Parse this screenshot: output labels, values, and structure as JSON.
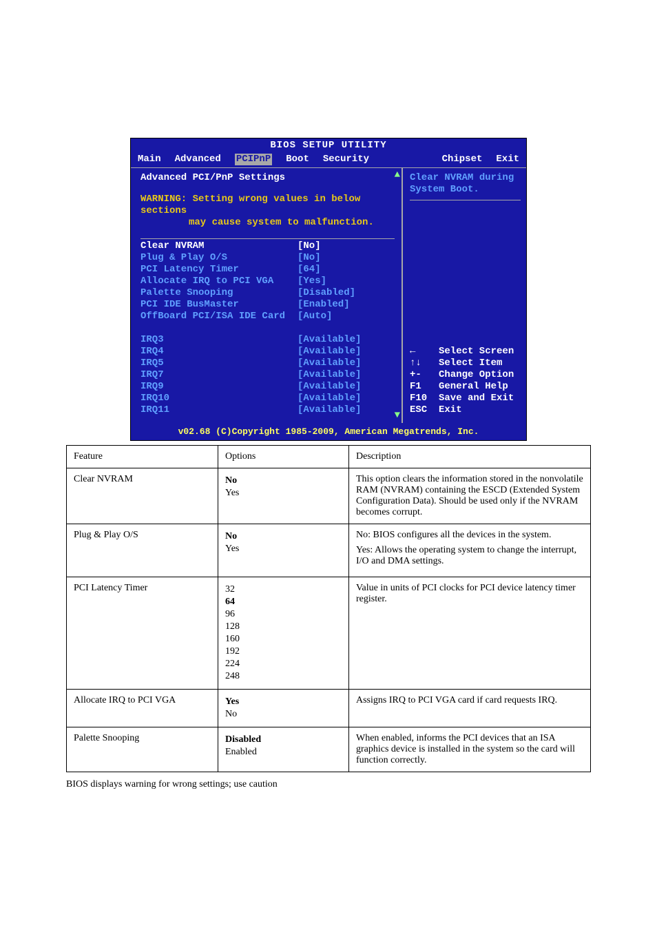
{
  "bios": {
    "title": "BIOS SETUP UTILITY",
    "menu": [
      "Main",
      "Advanced",
      "PCIPnP",
      "Boot",
      "Security",
      "Chipset",
      "Exit"
    ],
    "selected_menu_index": 2,
    "section_heading": "Advanced PCI/PnP Settings",
    "warning_line1": "WARNING: Setting wrong values in below sections",
    "warning_line2": "may cause system to malfunction.",
    "items": [
      {
        "label": "Clear NVRAM",
        "value": "[No]",
        "highlighted": true
      },
      {
        "label": "Plug & Play O/S",
        "value": "[No]"
      },
      {
        "label": "PCI Latency Timer",
        "value": "[64]"
      },
      {
        "label": "Allocate IRQ to PCI VGA",
        "value": "[Yes]"
      },
      {
        "label": "Palette Snooping",
        "value": "[Disabled]"
      },
      {
        "label": "PCI IDE BusMaster",
        "value": "[Enabled]"
      },
      {
        "label": "OffBoard PCI/ISA IDE Card",
        "value": "[Auto]"
      }
    ],
    "irqs": [
      {
        "label": "IRQ3",
        "value": "[Available]"
      },
      {
        "label": "IRQ4",
        "value": "[Available]"
      },
      {
        "label": "IRQ5",
        "value": "[Available]"
      },
      {
        "label": "IRQ7",
        "value": "[Available]"
      },
      {
        "label": "IRQ9",
        "value": "[Available]"
      },
      {
        "label": "IRQ10",
        "value": "[Available]"
      },
      {
        "label": "IRQ11",
        "value": "[Available]"
      }
    ],
    "help_text_l1": "Clear NVRAM during",
    "help_text_l2": "System Boot.",
    "keys": [
      {
        "k": "←",
        "d": "Select Screen"
      },
      {
        "k": "↑↓",
        "d": "Select Item"
      },
      {
        "k": "+-",
        "d": "Change Option"
      },
      {
        "k": "F1",
        "d": "General Help"
      },
      {
        "k": "F10",
        "d": "Save and Exit"
      },
      {
        "k": "ESC",
        "d": "Exit"
      }
    ],
    "footer": "v02.68 (C)Copyright 1985-2009, American Megatrends, Inc.",
    "scroll_up": "▲",
    "scroll_down": "▼"
  },
  "doc": {
    "head_feature": "Feature",
    "head_options": "Options",
    "head_desc": "Description",
    "rows": [
      {
        "feature": "Clear NVRAM",
        "options": [
          {
            "t": "No",
            "strong": true
          },
          {
            "t": "Yes"
          }
        ],
        "desc": "This option clears the information stored in the nonvolatile RAM (NVRAM) containing the ESCD (Extended System Configuration Data). Should be used only if the NVRAM becomes corrupt."
      },
      {
        "feature": "Plug & Play O/S",
        "options": [
          {
            "t": "No",
            "strong": true
          },
          {
            "t": "Yes"
          }
        ],
        "desc_multi": [
          "No: BIOS configures all the devices in the system.",
          "Yes: Allows the operating system to change the interrupt, I/O and DMA settings."
        ]
      },
      {
        "feature": "PCI Latency Timer",
        "options": [
          {
            "t": "32"
          },
          {
            "t": "64",
            "strong": true
          },
          {
            "t": "96"
          },
          {
            "t": "128"
          },
          {
            "t": "160"
          },
          {
            "t": "192"
          },
          {
            "t": "224"
          },
          {
            "t": "248"
          }
        ],
        "desc": "Value in units of PCI clocks for PCI device latency timer register."
      },
      {
        "feature": "Allocate IRQ to PCI VGA",
        "options": [
          {
            "t": "Yes",
            "strong": true
          },
          {
            "t": "No"
          }
        ],
        "desc": "Assigns IRQ to PCI VGA card if card requests IRQ."
      },
      {
        "feature": "Palette Snooping",
        "options": [
          {
            "t": "Disabled",
            "strong": true
          },
          {
            "t": "Enabled"
          }
        ],
        "desc": "When enabled, informs the PCI devices that an ISA graphics device is installed in the system so the card will function correctly."
      }
    ],
    "note": "BIOS displays warning for wrong settings; use caution"
  }
}
